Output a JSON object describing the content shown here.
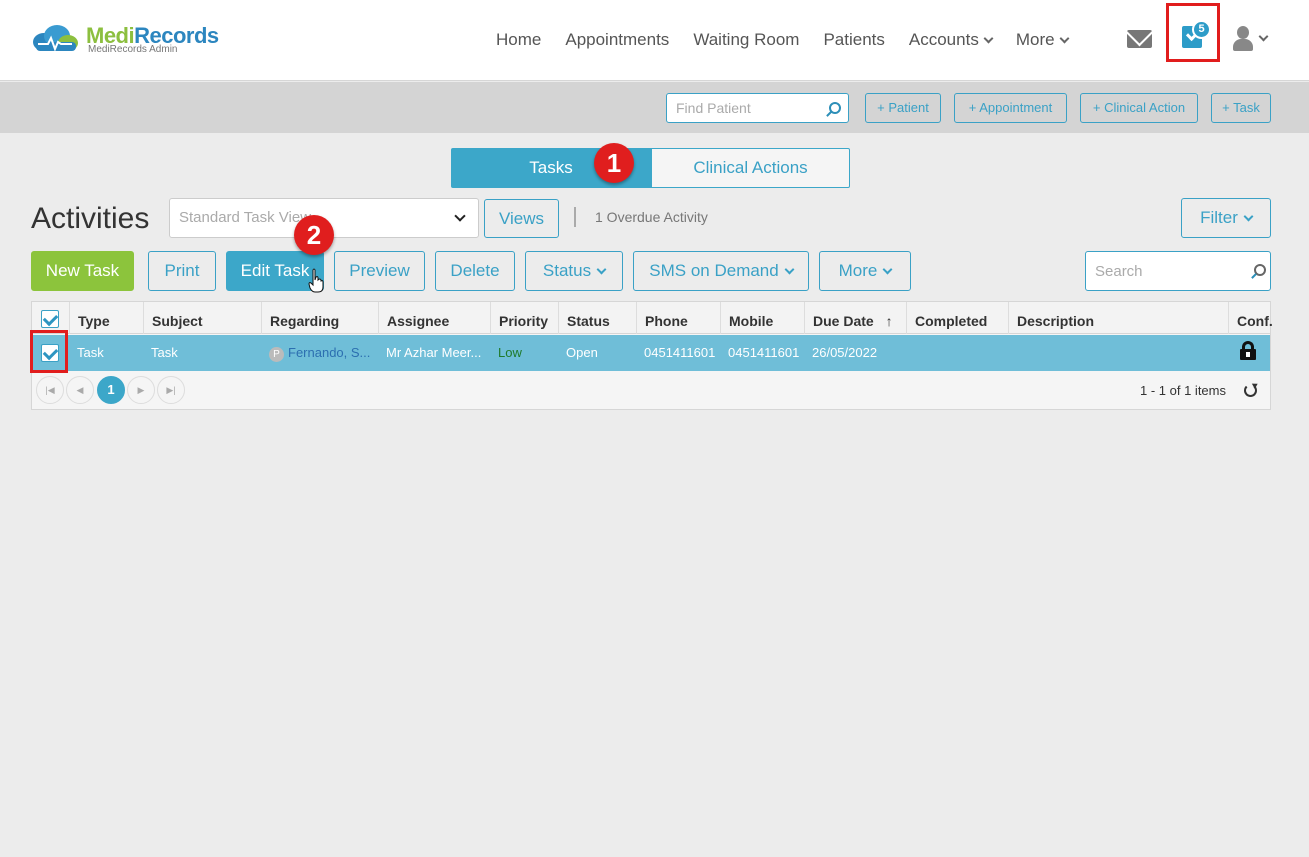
{
  "brand": {
    "name_part1": "Medi",
    "name_part2": "Records",
    "subtitle": "MediRecords Admin",
    "colors": {
      "green": "#8cbf3f",
      "blue": "#2c86bf"
    }
  },
  "nav": {
    "items": [
      {
        "label": "Home"
      },
      {
        "label": "Appointments"
      },
      {
        "label": "Waiting Room"
      },
      {
        "label": "Patients"
      },
      {
        "label": "Accounts"
      },
      {
        "label": "More"
      }
    ],
    "tasks_badge": "5",
    "icons": [
      "mail-icon",
      "tasks-icon",
      "user-icon"
    ]
  },
  "actionbar": {
    "find_placeholder": "Find Patient",
    "add_patient": "+ Patient",
    "add_appointment": "+ Appointment",
    "add_clinical_action": "+ Clinical Action",
    "add_task": "+ Task"
  },
  "tabs": {
    "tasks": "Tasks",
    "clinical_actions": "Clinical Actions"
  },
  "markers": {
    "one": "1",
    "two": "2"
  },
  "activities": {
    "title": "Activities",
    "view_select": "Standard Task View",
    "views_button": "Views",
    "overdue": "1 Overdue Activity",
    "filter_button": "Filter"
  },
  "toolbar": {
    "new_task": "New Task",
    "print": "Print",
    "edit_task": "Edit Task",
    "preview": "Preview",
    "delete": "Delete",
    "status": "Status",
    "sms": "SMS on Demand",
    "more": "More",
    "search_placeholder": "Search"
  },
  "grid": {
    "columns": [
      "Type",
      "Subject",
      "Regarding",
      "Assignee",
      "Priority",
      "Status",
      "Phone",
      "Mobile",
      "Due Date",
      "Completed",
      "Description",
      "Conf."
    ],
    "sort_arrow": "↑",
    "rows": [
      {
        "type": "Task",
        "subject": "Task",
        "regarding_badge": "P",
        "regarding": "Fernando, S...",
        "assignee": "Mr Azhar Meer...",
        "priority": "Low",
        "status": "Open",
        "phone": "0451411601",
        "mobile": "0451411601",
        "due_date": "26/05/2022",
        "completed": "",
        "description": ""
      }
    ],
    "pager": {
      "current_page": "1",
      "items_text": "1 - 1 of 1 items"
    }
  }
}
